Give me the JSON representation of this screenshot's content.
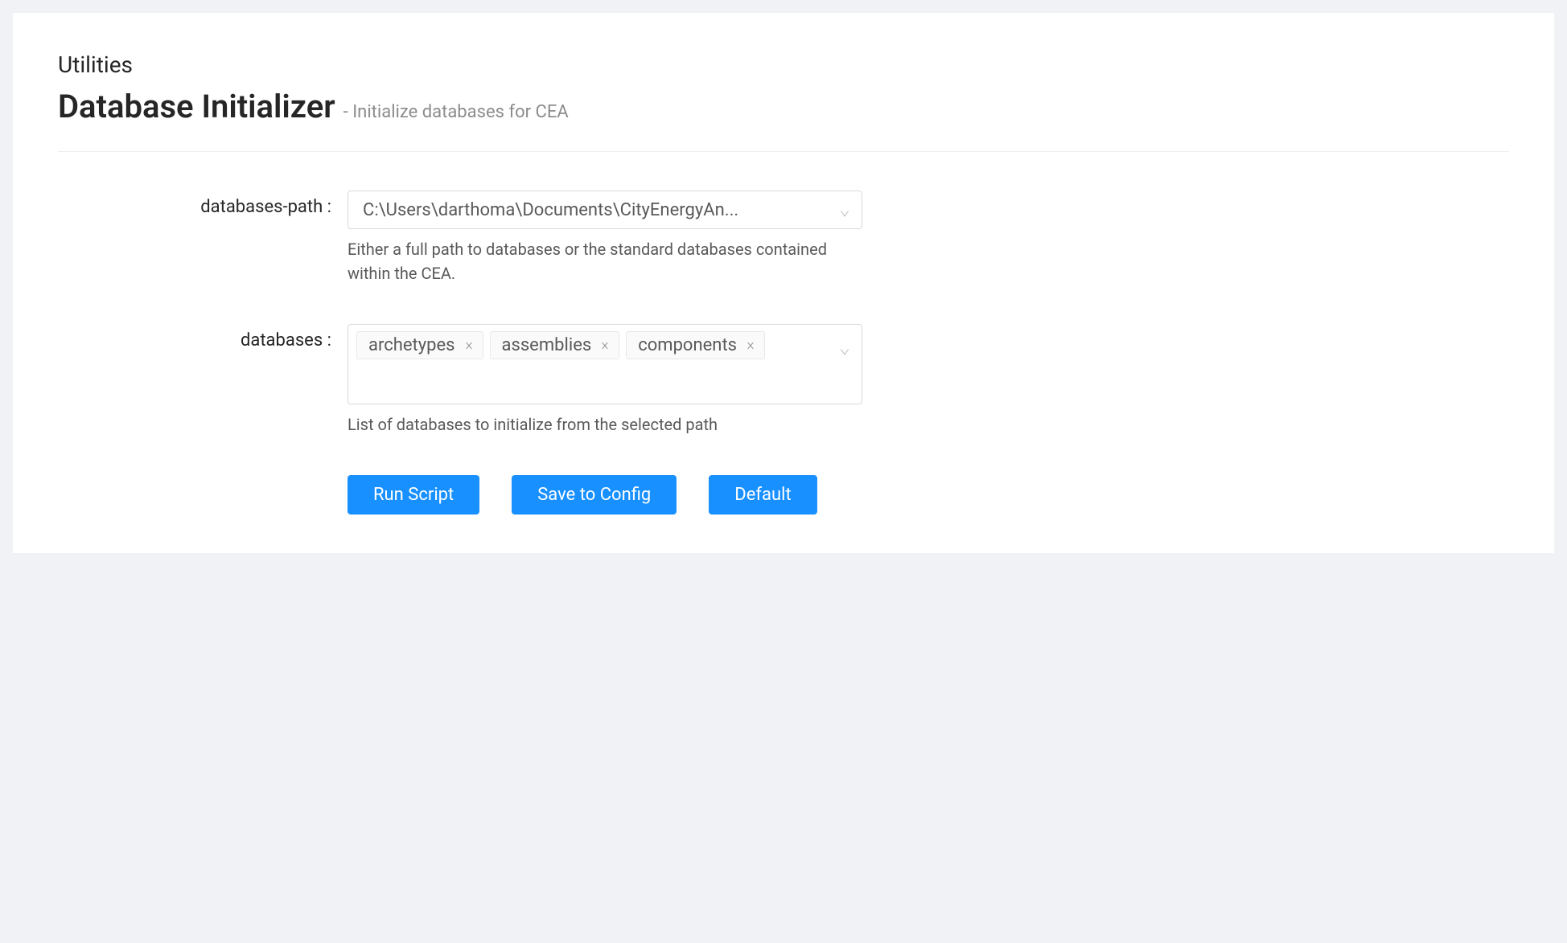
{
  "section_label": "Utilities",
  "page_title": "Database Initializer",
  "page_subtitle": "- Initialize databases for CEA",
  "form": {
    "databases_path": {
      "label": "databases-path",
      "value": "C:\\Users\\darthoma\\Documents\\CityEnergyAn...",
      "help": "Either a full path to databases or the standard databases contained within the CEA."
    },
    "databases": {
      "label": "databases",
      "tags": [
        "archetypes",
        "assemblies",
        "components"
      ],
      "help": "List of databases to initialize from the selected path"
    }
  },
  "buttons": {
    "run": "Run Script",
    "save": "Save to Config",
    "default": "Default"
  }
}
